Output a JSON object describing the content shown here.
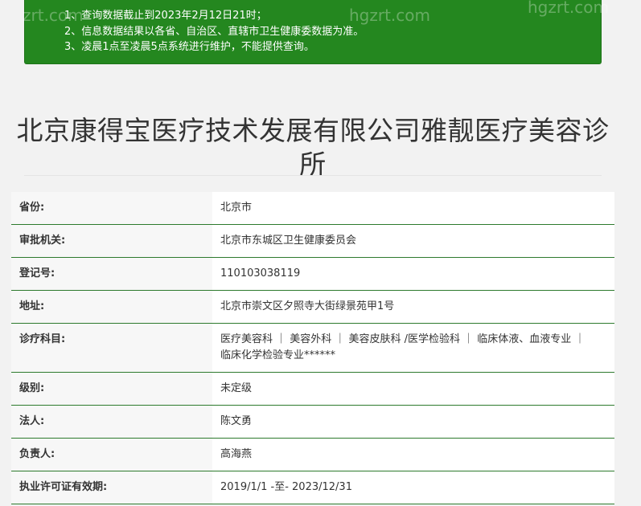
{
  "notice": {
    "lines": [
      "1、查询数据截止到2023年2月12日21时；",
      "2、信息数据结果以各省、自治区、直辖市卫生健康委数据为准。",
      "3、凌晨1点至凌晨5点系统进行维护，不能提供查询。"
    ],
    "watermarks": [
      "zrt.com",
      "hgzrt.com",
      "hgzrt.com"
    ]
  },
  "title": "北京康得宝医疗技术发展有限公司雅靓医疗美容诊所",
  "rows": [
    {
      "label": "省份:",
      "value": "北京市"
    },
    {
      "label": "审批机关:",
      "value": "北京市东城区卫生健康委员会"
    },
    {
      "label": "登记号:",
      "value": "110103038119"
    },
    {
      "label": "地址:",
      "value": "北京市崇文区夕照寺大街绿景苑甲1号"
    },
    {
      "label": "诊疗科目:",
      "value": "医疗美容科 ｜ 美容外科 ｜ 美容皮肤科 /医学检验科 ｜ 临床体液、血液专业 ｜ 临床化学检验专业******"
    },
    {
      "label": "级别:",
      "value": "未定级"
    },
    {
      "label": "法人:",
      "value": "陈文勇"
    },
    {
      "label": "负责人:",
      "value": "高海燕"
    },
    {
      "label": "执业许可证有效期:",
      "value": "2019/1/1 -至- 2023/12/31"
    }
  ]
}
